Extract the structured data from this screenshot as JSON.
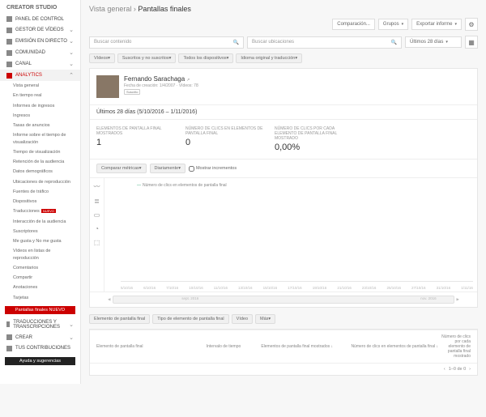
{
  "sidebar": {
    "title": "CREATOR STUDIO",
    "items": [
      {
        "label": "PANEL DE CONTROL"
      },
      {
        "label": "GESTOR DE VÍDEOS"
      },
      {
        "label": "EMISIÓN EN DIRECTO"
      },
      {
        "label": "COMUNIDAD"
      },
      {
        "label": "CANAL"
      },
      {
        "label": "ANALYTICS"
      },
      {
        "label": "TRADUCCIONES Y TRANSCRIPCIONES"
      },
      {
        "label": "CREAR"
      },
      {
        "label": "TUS CONTRIBUCIONES"
      }
    ],
    "analytics_subs": [
      "Vista general",
      "En tiempo real",
      "Informes de ingresos",
      "Ingresos",
      "Tasas de anuncios",
      "Informe sobre el tiempo de visualización",
      "Tiempo de visualización",
      "Retención de la audiencia",
      "Datos demográficos",
      "Ubicaciones de reproducción",
      "Fuentes de tráfico",
      "Dispositivos",
      "Traducciones",
      "Interacción de la audiencia",
      "Suscriptores",
      "Me gusta y No me gusta",
      "Vídeos en listas de reproducción",
      "Comentarios",
      "Compartir",
      "Anotaciones",
      "Tarjetas"
    ],
    "new_badge": "NUEVO",
    "red_button": "Pantallas finales NUEVO",
    "hint": "Ayuda y sugerencias"
  },
  "header": {
    "crumb1": "Vista general",
    "crumb2": "Pantallas finales",
    "compare": "Comparación...",
    "groups": "Grupos",
    "export": "Exportar informe",
    "search1_ph": "Buscar contenido",
    "search2_ph": "Buscar ubicaciones",
    "range_btn": "Últimos 28 días"
  },
  "filters": {
    "f1": "Vídeos",
    "f2": "Suscritos y no suscritos",
    "f3": "Todos los dispositivos",
    "f4": "Idioma original y traducción"
  },
  "channel": {
    "name": "Fernando Sarachaga",
    "meta": "Fecha de creación: 1/4/2007 · Vídeos: 78",
    "sub": "Suscrito"
  },
  "range_title": "Últimos 28 días (5/10/2016 – 1/11/2016)",
  "stats": {
    "s1_label": "ELEMENTOS DE PANTALLA FINAL MOSTRADOS",
    "s2_label": "NÚMERO DE CLICS EN ELEMENTOS DE PANTALLA FINAL",
    "s3_label": "NÚMERO DE CLICS POR CADA ELEMENTO DE PANTALLA FINAL MOSTRADO",
    "s1_val": "1",
    "s2_val": "0",
    "s3_val": "0,00%"
  },
  "opts": {
    "compare": "Comparar métricas",
    "daily": "Diariamente",
    "showinc": "Mostrar incrementos"
  },
  "chart": {
    "legend": "Número de clics en elementos de pantalla final",
    "ticks": [
      "5/10/16",
      "6/10/16",
      "7/10/16",
      "10/10/16",
      "11/10/16",
      "13/10/16",
      "15/10/16",
      "17/10/16",
      "19/10/16",
      "21/10/16",
      "23/10/16",
      "25/10/16",
      "27/10/16",
      "31/10/16",
      "1/11/16"
    ],
    "scroll_l": "sept. 2016",
    "scroll_r": "nov. 2016"
  },
  "tabs2": {
    "t1": "Elemento de pantalla final",
    "t2": "Tipo de elemento de pantalla final",
    "t3": "Vídeo",
    "t4": "Más"
  },
  "table": {
    "c1": "Elemento de pantalla final",
    "c2": "Intervalo de tiempo",
    "c3": "Elementos de pantalla final mostrados",
    "c4": "Número de clics en elementos de pantalla final",
    "c5": "Número de clics por cada elemento de pantalla final mostrado",
    "pager": "1–0 de 0"
  },
  "chart_data": {
    "type": "line",
    "title": "",
    "series": [
      {
        "name": "Número de clics en elementos de pantalla final",
        "values": [
          0,
          0,
          0,
          0,
          0,
          0,
          0,
          0,
          0,
          0,
          0,
          0,
          0,
          0,
          0
        ]
      }
    ],
    "categories": [
      "5/10/16",
      "6/10/16",
      "7/10/16",
      "10/10/16",
      "11/10/16",
      "13/10/16",
      "15/10/16",
      "17/10/16",
      "19/10/16",
      "21/10/16",
      "23/10/16",
      "25/10/16",
      "27/10/16",
      "31/10/16",
      "1/11/16"
    ],
    "ylim": [
      0,
      1
    ]
  }
}
